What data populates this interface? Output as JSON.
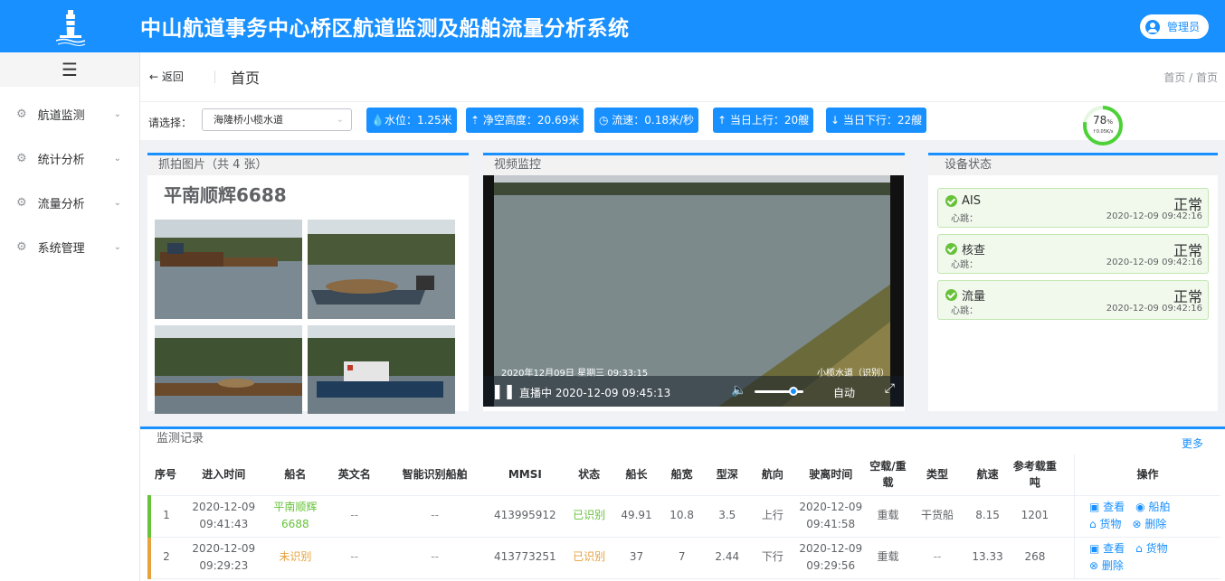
{
  "header": {
    "title": "中山航道事务中心桥区航道监测及船舶流量分析系统",
    "user": "管理员"
  },
  "sidebar": {
    "items": [
      {
        "label": "航道监测"
      },
      {
        "label": "统计分析"
      },
      {
        "label": "流量分析"
      },
      {
        "label": "系统管理"
      }
    ]
  },
  "topbar": {
    "back": "← 返回",
    "title": "首页",
    "breadcrumb": "首页 / 首页"
  },
  "filter": {
    "label": "请选择：",
    "selected": "海隆桥小榄水道",
    "stats": {
      "water": "水位：1.25米",
      "clearance": "净空高度：20.69米",
      "flow": "流速：0.18米/秒",
      "up": "当日上行：20艘",
      "down": "当日下行：22艘"
    },
    "gauge": {
      "value": "78",
      "unit": "%",
      "sub": "↑0.05K/s"
    }
  },
  "capture": {
    "title": "抓拍图片（共 4 张）",
    "ship": "平南顺辉6688"
  },
  "video": {
    "title": "视频监控",
    "osd_time": "2020年12月09日  星期三  09:33:15",
    "osd_name": "小榄水道（识别）",
    "live": "直播中 2020-12-09 09:45:13",
    "mode": "自动"
  },
  "device": {
    "title": "设备状态",
    "heartbeat_label": "心跳：",
    "items": [
      {
        "name": "AIS",
        "status": "正常",
        "time": "2020-12-09 09:42:16"
      },
      {
        "name": "核查",
        "status": "正常",
        "time": "2020-12-09 09:42:16"
      },
      {
        "name": "流量",
        "status": "正常",
        "time": "2020-12-09 09:42:16"
      }
    ]
  },
  "records": {
    "title": "监测记录",
    "more": "更多",
    "columns": [
      "序号",
      "进入时间",
      "船名",
      "英文名",
      "智能识别船舶",
      "MMSI",
      "状态",
      "船长",
      "船宽",
      "型深",
      "航向",
      "驶离时间",
      "空载/重载",
      "类型",
      "航速",
      "参考载重吨",
      "操作"
    ],
    "rows": [
      {
        "no": "1",
        "enter": "2020-12-09 09:41:43",
        "name": "平南顺辉6688",
        "en": "--",
        "ai": "--",
        "mmsi": "413995912",
        "status": "已识别",
        "len": "49.91",
        "width": "10.8",
        "depth": "3.5",
        "dir": "上行",
        "leave": "2020-12-09 09:41:58",
        "load": "重载",
        "type": "干货船",
        "speed": "8.15",
        "ton": "1201",
        "ops": [
          "查看",
          "船舶",
          "货物",
          "删除"
        ]
      },
      {
        "no": "2",
        "enter": "2020-12-09 09:29:23",
        "name": "未识别",
        "en": "--",
        "ai": "--",
        "mmsi": "413773251",
        "status": "已识别",
        "len": "37",
        "width": "7",
        "depth": "2.44",
        "dir": "下行",
        "leave": "2020-12-09 09:29:56",
        "load": "重载",
        "type": "--",
        "speed": "13.33",
        "ton": "268",
        "ops": [
          "查看",
          "货物",
          "删除"
        ]
      }
    ]
  },
  "colors": {
    "primary": "#1890ff",
    "success": "#67c23a",
    "warning": "#e6a23c"
  }
}
